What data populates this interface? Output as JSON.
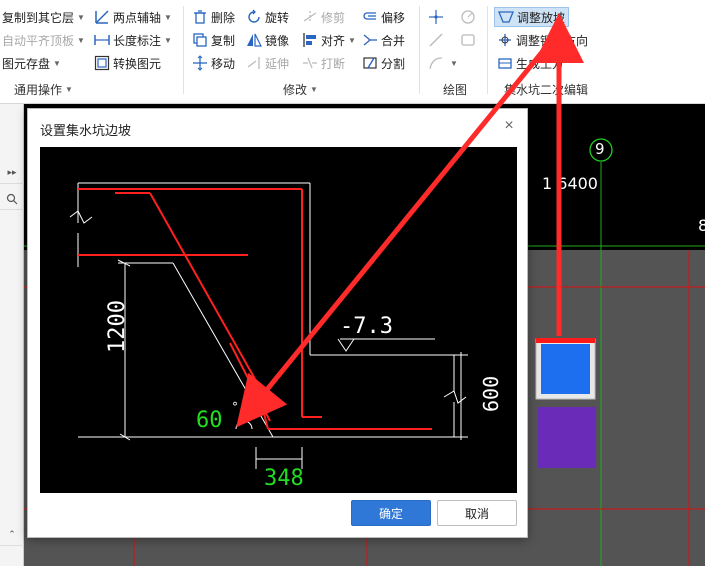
{
  "ribbon": {
    "general": {
      "copy_to_other_layer": "复制到其它层",
      "auto_flat_top": "自动平齐顶板",
      "element_save": "图元存盘",
      "group_label": "通用操作"
    },
    "axis": {
      "two_point_axis": "两点辅轴",
      "length_dim": "长度标注",
      "convert_element": "转换图元"
    },
    "modify": {
      "delete": "删除",
      "rotate": "旋转",
      "trim": "修剪",
      "offset": "偏移",
      "copy": "复制",
      "mirror": "镜像",
      "align": "对齐",
      "merge": "合并",
      "move": "移动",
      "extend": "延伸",
      "break": "打断",
      "split": "分割",
      "group_label": "修改"
    },
    "draw": {
      "group_label": "绘图"
    },
    "pit": {
      "adjust_slope": "调整放坡",
      "adjust_direction": "调整钢筋方向",
      "generate_earth": "生成土方",
      "group_label": "集水坑二次编辑"
    }
  },
  "canvas": {
    "axis_number": "9",
    "dimension_value": "1 6400",
    "right_label": "8"
  },
  "dialog": {
    "title": "设置集水坑边坡",
    "close_glyph": "×",
    "ok_label": "确定",
    "cancel_label": "取消",
    "drawing": {
      "depth_label": "1200",
      "elevation_label": "-7.3",
      "thickness_label": "600",
      "angle_label": "60",
      "angle_unit": "°",
      "offset_label": "348"
    }
  },
  "colors": {
    "accent": "#2f78d8",
    "annotation_arrow": "#ff2a2a",
    "cad_red": "#ff2020",
    "cad_green": "#22dd22",
    "pit_blue": "#1e6ff0",
    "pit_purple": "#6a2cb8"
  }
}
